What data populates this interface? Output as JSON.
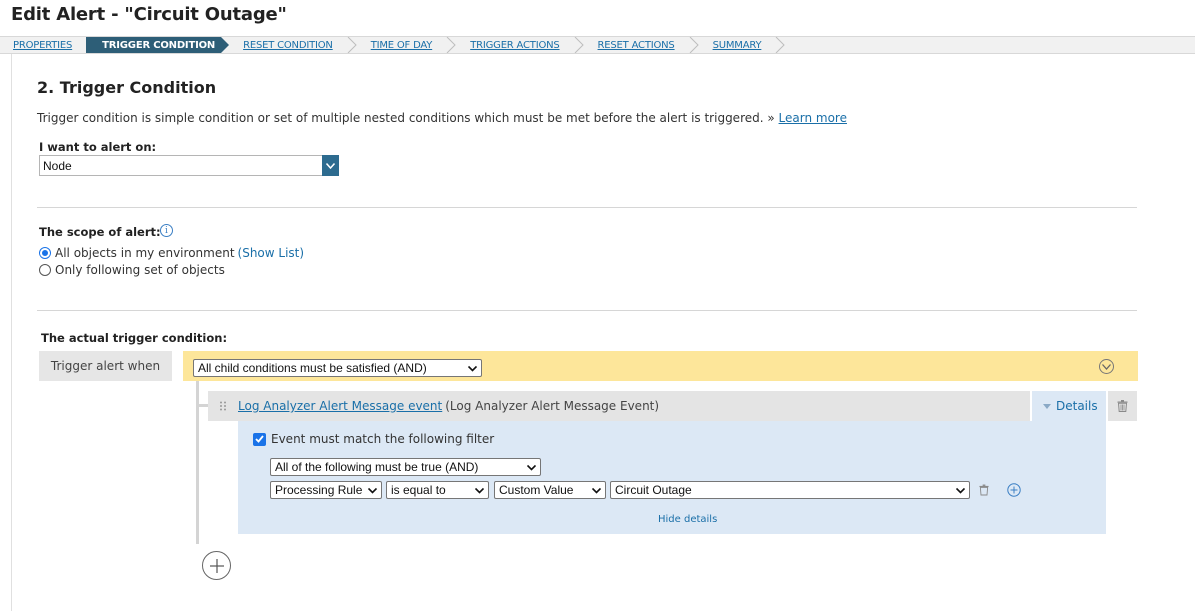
{
  "page": {
    "title": "Edit Alert - \"Circuit Outage\""
  },
  "wizard": {
    "steps": [
      {
        "label": "PROPERTIES"
      },
      {
        "label": "TRIGGER CONDITION"
      },
      {
        "label": "RESET CONDITION"
      },
      {
        "label": "TIME OF DAY"
      },
      {
        "label": "TRIGGER ACTIONS"
      },
      {
        "label": "RESET ACTIONS"
      },
      {
        "label": "SUMMARY"
      }
    ]
  },
  "section": {
    "title": "2. Trigger Condition",
    "description": "Trigger condition is simple condition or set of multiple nested conditions which must be met before the alert is triggered. »",
    "learn_more": "Learn more"
  },
  "alert_on": {
    "label": "I want to alert on:",
    "value": "Node"
  },
  "scope": {
    "label": "The scope of alert:",
    "option_all": "All objects in my environment",
    "show_list": "(Show List)",
    "option_following": "Only following set of objects",
    "selected": "all"
  },
  "trigger": {
    "label": "The actual trigger condition:",
    "when_label": "Trigger alert when",
    "logic_value": "All child conditions must be satisfied (AND)",
    "event_link": "Log Analyzer Alert Message event",
    "event_type": "(Log Analyzer Alert Message Event)",
    "details_label": "Details",
    "filter_check_label": "Event must match the following filter",
    "filter_logic": "All of the following must be true (AND)",
    "field": "Processing Rule",
    "operator": "is equal to",
    "value_type": "Custom Value",
    "value": "Circuit Outage",
    "hide_details": "Hide details"
  },
  "colors": {
    "accent": "#2d5e77",
    "link": "#1a6fa8",
    "yellow": "#fde69a",
    "panel_blue": "#dce8f5"
  }
}
